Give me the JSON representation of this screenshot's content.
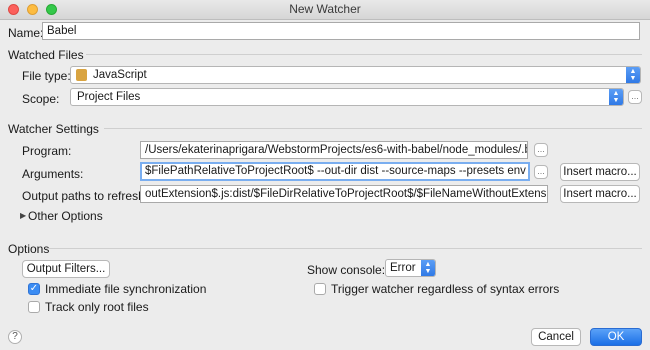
{
  "window": {
    "title": "New Watcher"
  },
  "name": {
    "label": "Name:",
    "value": "Babel"
  },
  "watched_files": {
    "section_title": "Watched Files",
    "file_type": {
      "label": "File type:",
      "value": "JavaScript",
      "icon": "javascript-file-icon"
    },
    "scope": {
      "label": "Scope:",
      "value": "Project Files",
      "more_label": "..."
    }
  },
  "watcher_settings": {
    "section_title": "Watcher Settings",
    "program": {
      "label": "Program:",
      "value": "/Users/ekaterinaprigara/WebstormProjects/es6-with-babel/node_modules/.bin/babel",
      "browse_label": "..."
    },
    "arguments": {
      "label": "Arguments:",
      "value": "$FilePathRelativeToProjectRoot$ --out-dir dist --source-maps  --presets env",
      "browse_label": "...",
      "insert_macro_label": "Insert macro..."
    },
    "output_paths": {
      "label": "Output paths to refresh:",
      "value": "outExtension$.js:dist/$FileDirRelativeToProjectRoot$/$FileNameWithoutExtension$.js.map",
      "insert_macro_label": "Insert macro..."
    },
    "other_options_label": "Other Options"
  },
  "options": {
    "section_title": "Options",
    "output_filters_label": "Output Filters...",
    "show_console_label": "Show console:",
    "show_console_value": "Error",
    "immediate_sync": {
      "label": "Immediate file synchronization",
      "checked": true
    },
    "track_root": {
      "label": "Track only root files",
      "checked": false
    },
    "trigger_regardless": {
      "label": "Trigger watcher regardless of syntax errors",
      "checked": false
    }
  },
  "footer": {
    "help_label": "?",
    "cancel_label": "Cancel",
    "ok_label": "OK"
  },
  "colors": {
    "accent": "#2d77e5",
    "focus_ring": "#7aaef0"
  }
}
